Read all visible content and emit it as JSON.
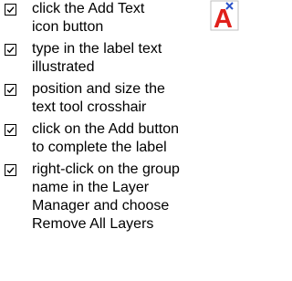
{
  "checklist": {
    "items": [
      {
        "lines": [
          "click the Add Text",
          "icon button"
        ]
      },
      {
        "lines": [
          "type in the label text",
          "illustrated"
        ]
      },
      {
        "lines": [
          "position and size the",
          "text tool crosshair"
        ]
      },
      {
        "lines": [
          "click on the Add button",
          "to complete the label"
        ]
      },
      {
        "lines": [
          "right-click on the group",
          "name in the Layer",
          "Manager and choose",
          "Remove All Layers"
        ]
      }
    ]
  },
  "icon": {
    "name": "add-text-icon",
    "letter": "A",
    "color": "#e0201a",
    "mark_color": "#2a52c9"
  }
}
